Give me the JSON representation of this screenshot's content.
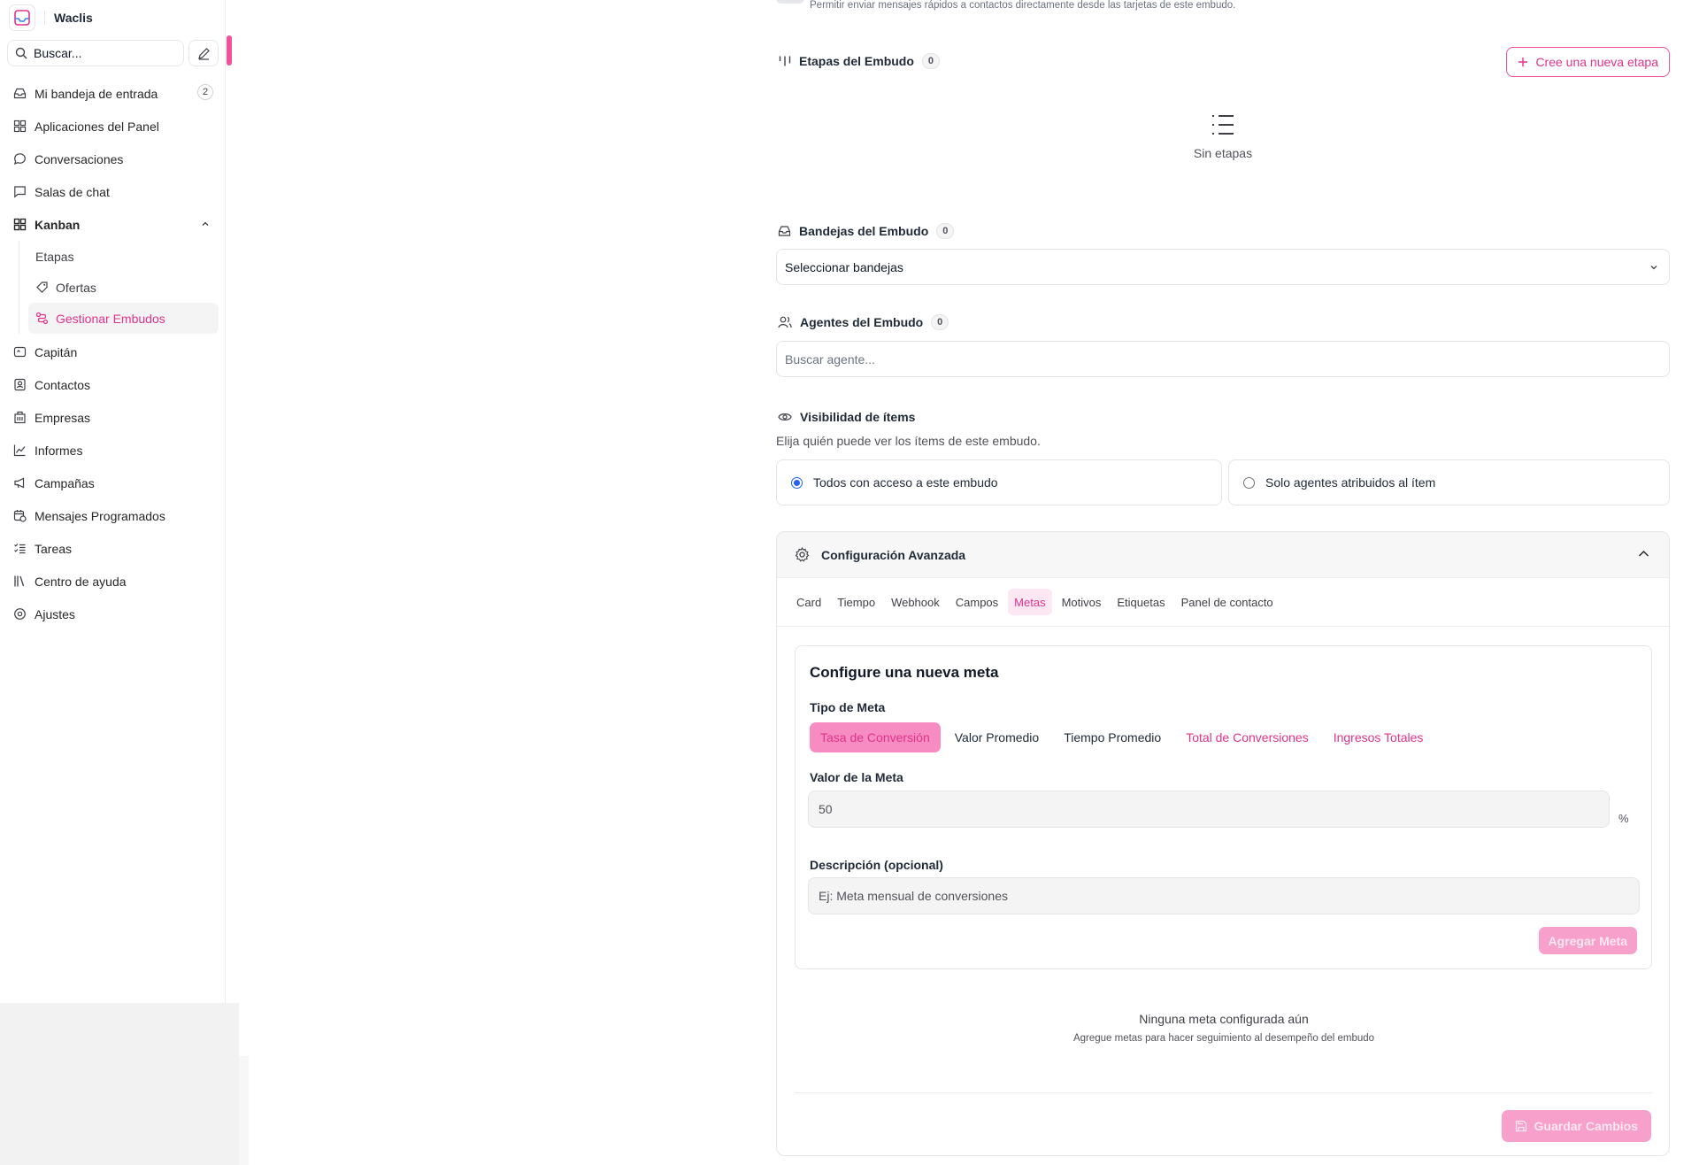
{
  "sidebar": {
    "brand": "Waclis",
    "search_label": "Buscar...",
    "items": [
      {
        "label": "Mi bandeja de entrada",
        "badge": "2"
      },
      {
        "label": "Aplicaciones del Panel"
      },
      {
        "label": "Conversaciones"
      },
      {
        "label": "Salas de chat"
      },
      {
        "label": "Kanban"
      },
      {
        "label": "Capitán"
      },
      {
        "label": "Contactos"
      },
      {
        "label": "Empresas"
      },
      {
        "label": "Informes"
      },
      {
        "label": "Campañas"
      },
      {
        "label": "Mensajes Programados"
      },
      {
        "label": "Tareas"
      },
      {
        "label": "Centro de ayuda"
      },
      {
        "label": "Ajustes"
      }
    ],
    "kanban_sub": [
      {
        "label": "Etapas"
      },
      {
        "label": "Ofertas"
      },
      {
        "label": "Gestionar Embudos"
      }
    ]
  },
  "main": {
    "top_hint": "Permitir enviar mensajes rápidos a contactos directamente desde las tarjetas de este embudo.",
    "stages": {
      "title": "Etapas del Embudo",
      "count": "0",
      "new_button": "Cree una nueva etapa",
      "empty": "Sin etapas"
    },
    "inboxes": {
      "title": "Bandejas del Embudo",
      "count": "0",
      "placeholder": "Seleccionar bandejas"
    },
    "agents": {
      "title": "Agentes del Embudo",
      "count": "0",
      "placeholder": "Buscar agente..."
    },
    "visibility": {
      "title": "Visibilidad de ítems",
      "description": "Elija quién puede ver los ítems de este embudo.",
      "option_all": "Todos con acceso a este embudo",
      "option_assigned": "Solo agentes atribuidos al ítem"
    },
    "advanced": {
      "title": "Configuración Avanzada",
      "tabs": [
        "Card",
        "Tiempo",
        "Webhook",
        "Campos",
        "Metas",
        "Motivos",
        "Etiquetas",
        "Panel de contacto"
      ],
      "goal": {
        "title": "Configure una nueva meta",
        "type_label": "Tipo de Meta",
        "types": [
          "Tasa de Conversión",
          "Valor Promedio",
          "Tiempo Promedio",
          "Total de Conversiones",
          "Ingresos Totales"
        ],
        "value_label": "Valor de la Meta",
        "value": "50",
        "unit": "%",
        "desc_label": "Descripción (opcional)",
        "desc_placeholder": "Ej: Meta mensual de conversiones",
        "add_button": "Agregar Meta"
      },
      "empty_title": "Ninguna meta configurada aún",
      "empty_sub": "Agregue metas para hacer seguimiento al desempeño del embudo",
      "save_button": "Guardar Cambios"
    }
  },
  "colors": {
    "accent": "#e0338a",
    "accent_soft": "#f7a0cb",
    "radio": "#2563eb"
  }
}
